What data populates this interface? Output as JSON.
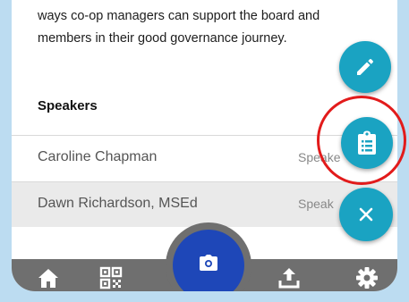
{
  "session": {
    "description_lines": [
      "ways co-op managers can support the board and",
      "members in their good governance journey."
    ]
  },
  "speakers": {
    "heading": "Speakers",
    "items": [
      {
        "name": "Caroline Chapman",
        "role": "Speake"
      },
      {
        "name": "Dawn Richardson, MSEd",
        "role": "Speak"
      }
    ]
  },
  "fab_menu": {
    "items": [
      "pencil-icon",
      "clipboard-list-icon",
      "close-icon"
    ],
    "color": "#1aa3c2"
  },
  "bottom_nav": {
    "items": [
      "home-icon",
      "qr-code-icon",
      "camera-icon",
      "upload-icon",
      "gear-icon"
    ],
    "bar_color": "#6f6f6f",
    "camera_color": "#1e47b8"
  },
  "annotation": {
    "highlight_color": "#e21b1b"
  }
}
